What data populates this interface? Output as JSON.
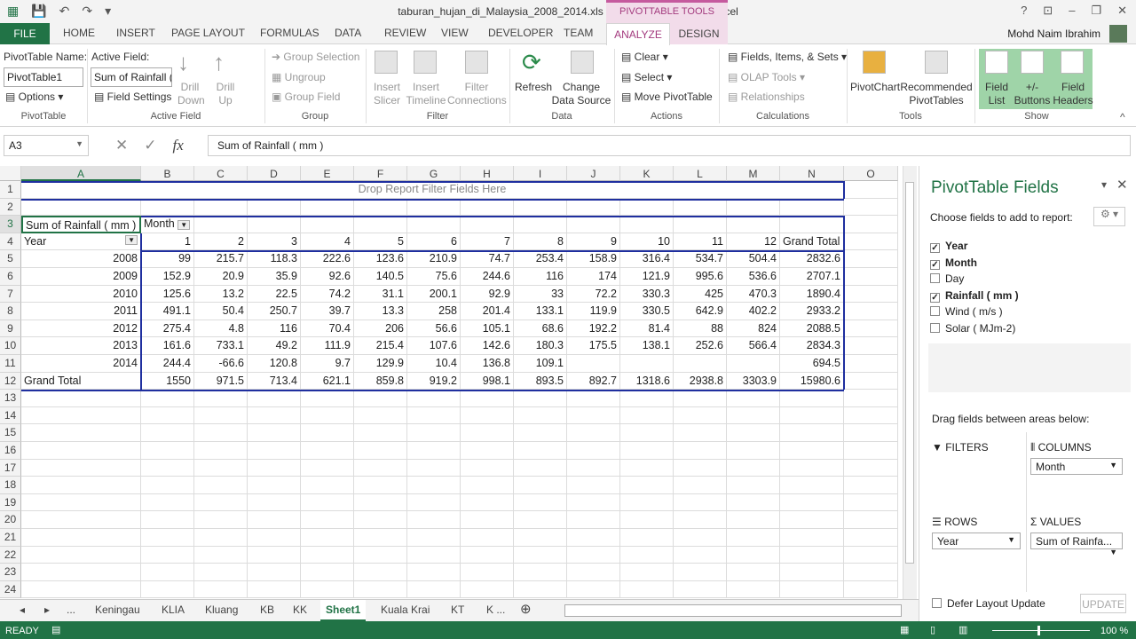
{
  "window": {
    "title": "taburan_hujan_di_Malaysia_2008_2014.xls  [Compatibility Mode] - Excel",
    "context_tab": "PIVOTTABLE TOOLS",
    "user": "Mohd Naim Ibrahim"
  },
  "tabs": [
    "FILE",
    "HOME",
    "INSERT",
    "PAGE LAYOUT",
    "FORMULAS",
    "DATA",
    "REVIEW",
    "VIEW",
    "DEVELOPER",
    "TEAM",
    "ANALYZE",
    "DESIGN"
  ],
  "ribbon": {
    "pt_name_label": "PivotTable Name:",
    "pt_name": "PivotTable1",
    "options": "Options",
    "grp_pivottable": "PivotTable",
    "af_label": "Active Field:",
    "af_value": "Sum of Rainfall ( r",
    "field_settings": "Field Settings",
    "drill_down": "Drill Down",
    "drill_up": "Drill Up",
    "grp_active": "Active Field",
    "group_selection": "Group Selection",
    "ungroup": "Ungroup",
    "group_field": "Group Field",
    "grp_group": "Group",
    "insert_slicer": "Insert Slicer",
    "insert_timeline": "Insert Timeline",
    "filter_conn": "Filter Connections",
    "grp_filter": "Filter",
    "refresh": "Refresh",
    "change_source": "Change Data Source",
    "grp_data": "Data",
    "clear": "Clear",
    "select": "Select",
    "move": "Move PivotTable",
    "grp_actions": "Actions",
    "fields_items": "Fields, Items, & Sets",
    "olap": "OLAP Tools",
    "relationships": "Relationships",
    "grp_calc": "Calculations",
    "pivotchart": "PivotChart",
    "recommended": "Recommended PivotTables",
    "grp_tools": "Tools",
    "field_list": "Field List",
    "buttons": "+/- Buttons",
    "field_headers": "Field Headers",
    "grp_show": "Show"
  },
  "formula_bar": {
    "name_box": "A3",
    "formula": "Sum of Rainfall ( mm )"
  },
  "columns": [
    "A",
    "B",
    "C",
    "D",
    "E",
    "F",
    "G",
    "H",
    "I",
    "J",
    "K",
    "L",
    "M",
    "N",
    "O"
  ],
  "rows": [
    1,
    2,
    3,
    4,
    5,
    6,
    7,
    8,
    9,
    10,
    11,
    12,
    13,
    14,
    15,
    16,
    17,
    18,
    19,
    20,
    21,
    22,
    23,
    24
  ],
  "pivot": {
    "filter_drop": "Drop Report Filter Fields Here",
    "value_label": "Sum of Rainfall ( mm )",
    "col_field": "Month",
    "row_field": "Year",
    "months": [
      "1",
      "2",
      "3",
      "4",
      "5",
      "6",
      "7",
      "8",
      "9",
      "10",
      "11",
      "12"
    ],
    "grand_total": "Grand Total",
    "data": [
      [
        "2008",
        "99",
        "215.7",
        "118.3",
        "222.6",
        "123.6",
        "210.9",
        "74.7",
        "253.4",
        "158.9",
        "316.4",
        "534.7",
        "504.4",
        "2832.6"
      ],
      [
        "2009",
        "152.9",
        "20.9",
        "35.9",
        "92.6",
        "140.5",
        "75.6",
        "244.6",
        "116",
        "174",
        "121.9",
        "995.6",
        "536.6",
        "2707.1"
      ],
      [
        "2010",
        "125.6",
        "13.2",
        "22.5",
        "74.2",
        "31.1",
        "200.1",
        "92.9",
        "33",
        "72.2",
        "330.3",
        "425",
        "470.3",
        "1890.4"
      ],
      [
        "2011",
        "491.1",
        "50.4",
        "250.7",
        "39.7",
        "13.3",
        "258",
        "201.4",
        "133.1",
        "119.9",
        "330.5",
        "642.9",
        "402.2",
        "2933.2"
      ],
      [
        "2012",
        "275.4",
        "4.8",
        "116",
        "70.4",
        "206",
        "56.6",
        "105.1",
        "68.6",
        "192.2",
        "81.4",
        "88",
        "824",
        "2088.5"
      ],
      [
        "2013",
        "161.6",
        "733.1",
        "49.2",
        "111.9",
        "215.4",
        "107.6",
        "142.6",
        "180.3",
        "175.5",
        "138.1",
        "252.6",
        "566.4",
        "2834.3"
      ],
      [
        "2014",
        "244.4",
        "-66.6",
        "120.8",
        "9.7",
        "129.9",
        "10.4",
        "136.8",
        "109.1",
        "",
        "",
        "",
        "",
        "694.5"
      ],
      [
        "Grand Total",
        "1550",
        "971.5",
        "713.4",
        "621.1",
        "859.8",
        "919.2",
        "998.1",
        "893.5",
        "892.7",
        "1318.6",
        "2938.8",
        "3303.9",
        "15980.6"
      ]
    ]
  },
  "pane": {
    "title": "PivotTable Fields",
    "choose": "Choose fields to add to report:",
    "fields": [
      {
        "name": "Year",
        "checked": true
      },
      {
        "name": "Month",
        "checked": true
      },
      {
        "name": "Day",
        "checked": false
      },
      {
        "name": "Rainfall ( mm )",
        "checked": true
      },
      {
        "name": "Wind ( m/s )",
        "checked": false
      },
      {
        "name": "Solar ( MJm-2)",
        "checked": false
      }
    ],
    "drag": "Drag fields between areas below:",
    "filters": "FILTERS",
    "columns": "COLUMNS",
    "rows": "ROWS",
    "values": "VALUES",
    "columns_item": "Month",
    "rows_item": "Year",
    "values_item": "Sum of Rainfa...",
    "defer": "Defer Layout Update",
    "update": "UPDATE"
  },
  "sheets": [
    "Keningau",
    "KLIA",
    "Kluang",
    "KB",
    "KK",
    "Sheet1",
    "Kuala Krai",
    "KT",
    "K ..."
  ],
  "active_sheet": "Sheet1",
  "status": {
    "ready": "READY",
    "zoom": "100 %"
  }
}
